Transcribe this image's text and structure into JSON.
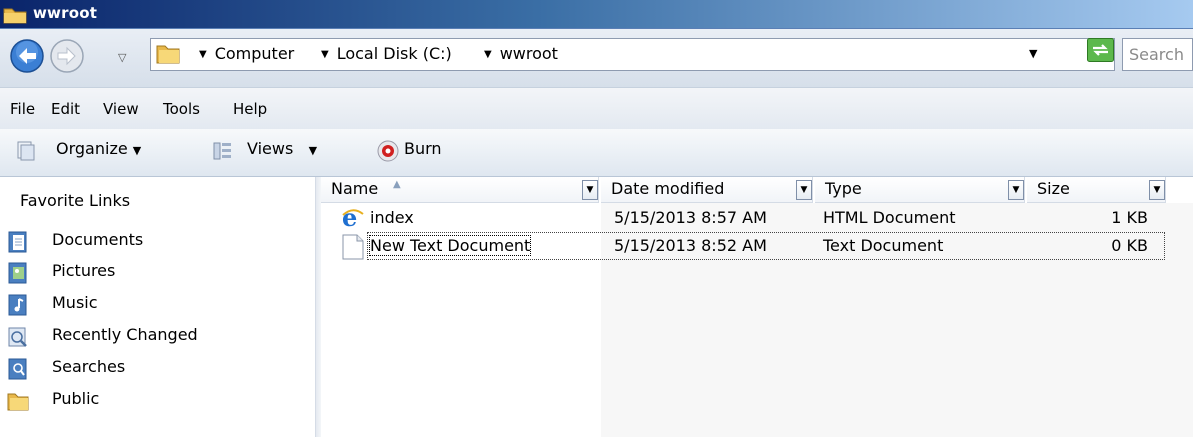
{
  "window": {
    "title": "wwroot"
  },
  "address": {
    "crumbs": [
      "Computer",
      "Local Disk (C:)",
      "wwroot"
    ],
    "search_placeholder": "Search"
  },
  "menu": [
    "File",
    "Edit",
    "View",
    "Tools",
    "Help"
  ],
  "toolbar": {
    "organize": "Organize",
    "views": "Views",
    "burn": "Burn"
  },
  "sidebar": {
    "heading": "Favorite Links",
    "links": [
      "Documents",
      "Pictures",
      "Music",
      "Recently Changed",
      "Searches",
      "Public"
    ]
  },
  "columns": [
    "Name",
    "Date modified",
    "Type",
    "Size"
  ],
  "files": [
    {
      "name": "index",
      "date": "5/15/2013 8:57 AM",
      "type": "HTML Document",
      "size": "1 KB",
      "icon": "ie-html-icon"
    },
    {
      "name": "New Text Document",
      "date": "5/15/2013 8:52 AM",
      "type": "Text Document",
      "size": "0 KB",
      "icon": "text-file-icon"
    }
  ]
}
